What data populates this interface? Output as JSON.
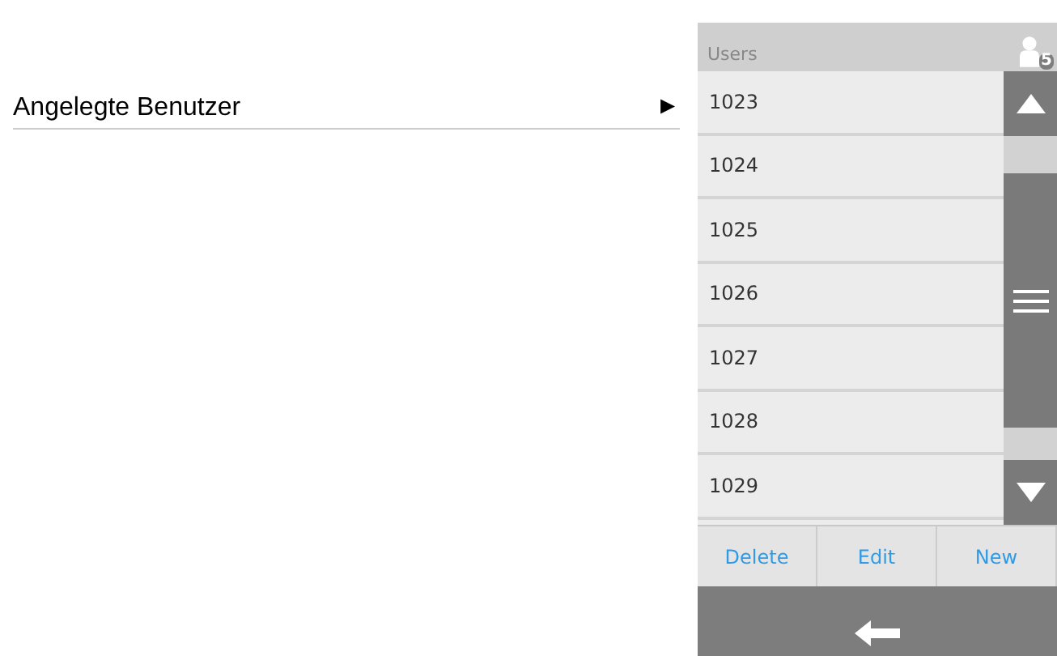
{
  "menu_item": {
    "label": "Angelegte Benutzer",
    "arrow": "►"
  },
  "panel": {
    "title": "Users",
    "user_badge": "5"
  },
  "users": [
    "1023",
    "1024",
    "1025",
    "1026",
    "1027",
    "1028",
    "1029"
  ],
  "buttons": [
    "Delete",
    "Edit",
    "New"
  ]
}
